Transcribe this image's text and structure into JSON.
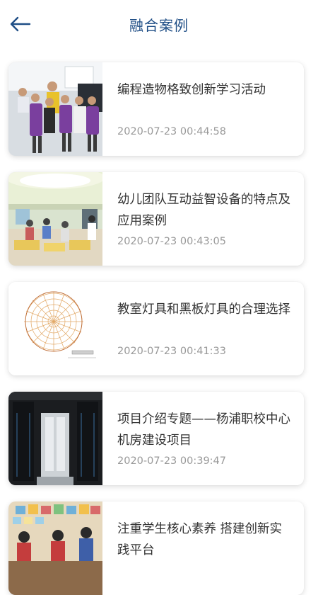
{
  "header": {
    "title": "融合案例",
    "back_icon": "arrow-left-icon",
    "title_color": "#1f4e86"
  },
  "cases": [
    {
      "title": "编程造物格致创新学习活动",
      "date": "2020-07-23 00:44:58",
      "image": "students-in-purple-aprons-photo"
    },
    {
      "title": "幼儿团队互动益智设备的特点及应用案例",
      "date": "2020-07-23 00:43:05",
      "image": "kindergarten-classroom-photo"
    },
    {
      "title": "教室灯具和黑板灯具的合理选择",
      "date": "2020-07-23 00:41:33",
      "image": "light-distribution-diagram"
    },
    {
      "title": "项目介绍专题——杨浦职校中心机房建设项目",
      "date": "2020-07-23 00:39:47",
      "image": "server-room-photo"
    },
    {
      "title": "注重学生核心素养 搭建创新实践平台",
      "date": "",
      "image": "students-at-desk-photo"
    }
  ]
}
